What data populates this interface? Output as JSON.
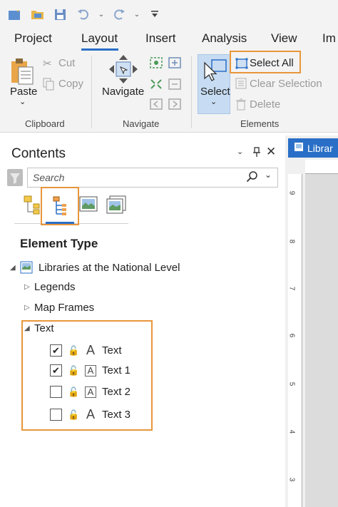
{
  "ribbon_tabs": [
    {
      "label": "Project"
    },
    {
      "label": "Layout"
    },
    {
      "label": "Insert"
    },
    {
      "label": "Analysis"
    },
    {
      "label": "View"
    },
    {
      "label": "Im"
    }
  ],
  "clipboard": {
    "paste_label": "Paste",
    "cut_label": "Cut",
    "copy_label": "Copy",
    "group_label": "Clipboard"
  },
  "navigate": {
    "navigate_label": "Navigate",
    "group_label": "Navigate"
  },
  "elements": {
    "select_label": "Select",
    "select_all_label": "Select All",
    "clear_selection_label": "Clear Selection",
    "delete_label": "Delete",
    "group_label": "Elements"
  },
  "contents": {
    "title": "Contents",
    "search_placeholder": "Search",
    "section_title": "Element Type",
    "root_label": "Libraries at the National Level",
    "legends_label": "Legends",
    "map_frames_label": "Map Frames",
    "text_group_label": "Text",
    "text_items": [
      {
        "label": "Text",
        "checked": true
      },
      {
        "label": "Text 1",
        "checked": true
      },
      {
        "label": "Text 2",
        "checked": false
      },
      {
        "label": "Text 3",
        "checked": false
      }
    ]
  },
  "layout_view": {
    "tab_label": "Librar",
    "ruler_ticks": [
      "9",
      "8",
      "7",
      "6",
      "5",
      "4",
      "3"
    ]
  },
  "colors": {
    "accent": "#2a6fc7",
    "highlight": "#e8963c",
    "ribbon_bg": "#f3f3f3"
  }
}
